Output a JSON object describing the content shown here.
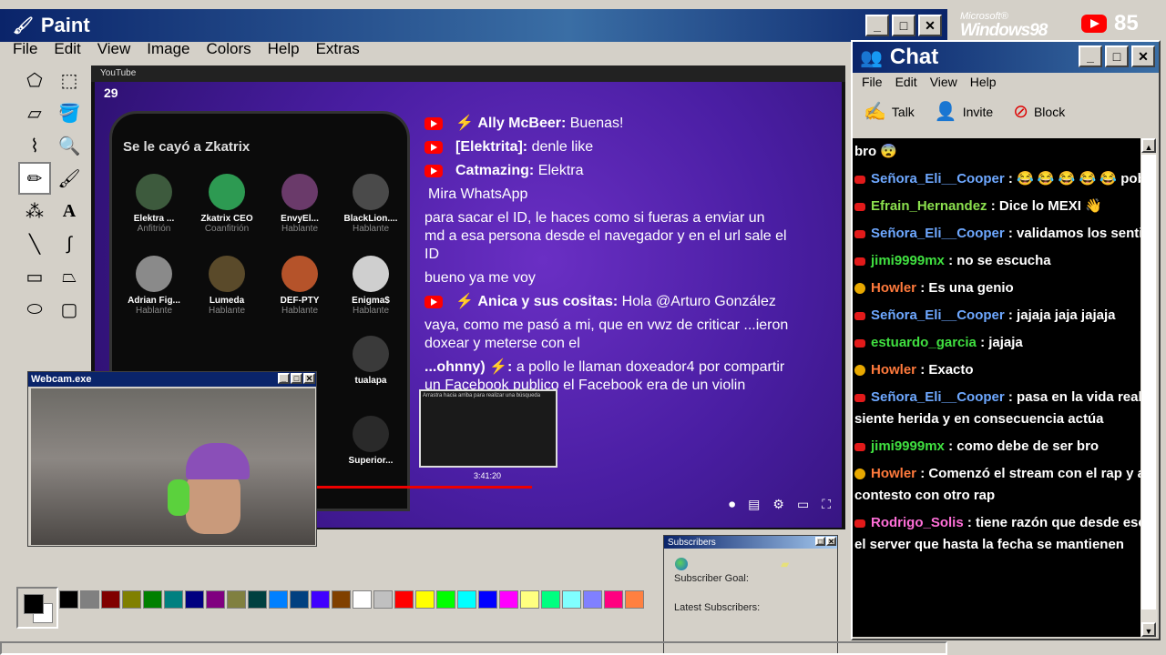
{
  "paint": {
    "title": "Paint",
    "menu": [
      "File",
      "Edit",
      "View",
      "Image",
      "Colors",
      "Help",
      "Extras"
    ],
    "palette": [
      "#000000",
      "#808080",
      "#800000",
      "#808000",
      "#008000",
      "#008080",
      "#000080",
      "#800080",
      "#808040",
      "#004040",
      "#0080ff",
      "#004080",
      "#4000ff",
      "#804000",
      "#ffffff",
      "#c0c0c0",
      "#ff0000",
      "#ffff00",
      "#00ff00",
      "#00ffff",
      "#0000ff",
      "#ff00ff",
      "#ffff80",
      "#00ff80",
      "#80ffff",
      "#8080ff",
      "#ff0080",
      "#ff8040"
    ]
  },
  "stream": {
    "top_label": "YouTube",
    "viewer_count": "29",
    "phone_title": "Se le cayó a Zkatrix",
    "members": [
      {
        "name": "Elektra ...",
        "role": "Anfitrión"
      },
      {
        "name": "Zkatrix CEO",
        "role": "Coanfitrión"
      },
      {
        "name": "EnvyEl...",
        "role": "Hablante"
      },
      {
        "name": "BlackLion....",
        "role": "Hablante"
      },
      {
        "name": "Adrian Fig...",
        "role": "Hablante"
      },
      {
        "name": "Lumeda",
        "role": "Hablante"
      },
      {
        "name": "DEF-PTY",
        "role": "Hablante"
      },
      {
        "name": "Enigma$",
        "role": "Hablante"
      },
      {
        "name": "tualapa",
        "role": "Hablante"
      },
      {
        "name": "Superior...",
        "role": ""
      }
    ],
    "chat": [
      {
        "name": "Ally McBeer:",
        "text": "Buenas!"
      },
      {
        "name": "[Elektrita]:",
        "text": "denle like"
      },
      {
        "name": "Catmazing:",
        "text": "Elektra"
      },
      {
        "name": "",
        "text": "Mira WhatsApp"
      },
      {
        "name": "",
        "text": "para sacar el ID, le haces como si fueras a enviar un md a esa persona desde el navegador y en el url sale el ID"
      },
      {
        "name": "",
        "text": "bueno ya me voy"
      },
      {
        "name": "Anica y sus cositas:",
        "text": "Hola @Arturo González"
      },
      {
        "name": "",
        "text": "vaya, como me pasó a mi, que en vwz de criticar ...ieron doxear y meterse con el"
      },
      {
        "name": "...ohnny) ⚡:",
        "text": "a pollo le llaman doxeador4 por compartir un Facebook publico el Facebook era de un violin"
      }
    ],
    "preview_time": "3:41:20",
    "preview_hint": "Arrastra hacia arriba para realizar una búsqueda"
  },
  "webcam": {
    "title": "Webcam.exe"
  },
  "subscribers": {
    "title": "Subscribers",
    "goal_label": "Subscriber Goal:",
    "latest_label": "Latest Subscribers:"
  },
  "brand": {
    "microsoft": "Microsoft®",
    "windows": "Windows98",
    "yt_count": "85"
  },
  "chat": {
    "title": "Chat",
    "menu": [
      "File",
      "Edit",
      "View",
      "Help"
    ],
    "toolbar": [
      "Talk",
      "Invite",
      "Block"
    ],
    "messages": [
      {
        "badge": "none",
        "user": "",
        "color": "#ffffff",
        "text": "bro 😨"
      },
      {
        "badge": "yt",
        "user": "Señora_Eli__Cooper",
        "color": "#6ea8ff",
        "text": ": 😂 😂 😂 😂 😂 pobre !"
      },
      {
        "badge": "yt",
        "user": "Efrain_Hernandez",
        "color": "#8be04e",
        "text": ": Dice lo MEXI 👋"
      },
      {
        "badge": "yt",
        "user": "Señora_Eli__Cooper",
        "color": "#6ea8ff",
        "text": ": validamos los sentimie"
      },
      {
        "badge": "yt",
        "user": "jimi9999mx",
        "color": "#40e040",
        "text": ": no se escucha"
      },
      {
        "badge": "star",
        "user": "Howler",
        "color": "#ff7a3c",
        "text": ": Es una genio"
      },
      {
        "badge": "yt",
        "user": "Señora_Eli__Cooper",
        "color": "#6ea8ff",
        "text": ": jajaja jaja jajaja"
      },
      {
        "badge": "yt",
        "user": "estuardo_garcia",
        "color": "#40e040",
        "text": ": jajaja"
      },
      {
        "badge": "star",
        "user": "Howler",
        "color": "#ff7a3c",
        "text": ": Exacto"
      },
      {
        "badge": "yt",
        "user": "Señora_Eli__Cooper",
        "color": "#6ea8ff",
        "text": ": pasa en la vida real, un siente herida y en consecuencia actúa"
      },
      {
        "badge": "yt",
        "user": "jimi9999mx",
        "color": "#40e040",
        "text": ": como debe de ser bro"
      },
      {
        "badge": "star",
        "user": "Howler",
        "color": "#ff7a3c",
        "text": ": Comenzó el stream con el rap y al contesto con otro rap"
      },
      {
        "badge": "yt",
        "user": "Rodrigo_Solis",
        "color": "#ff6fd8",
        "text": ": tiene razón que desde ese sp el server que hasta la fecha se mantienen"
      }
    ]
  }
}
